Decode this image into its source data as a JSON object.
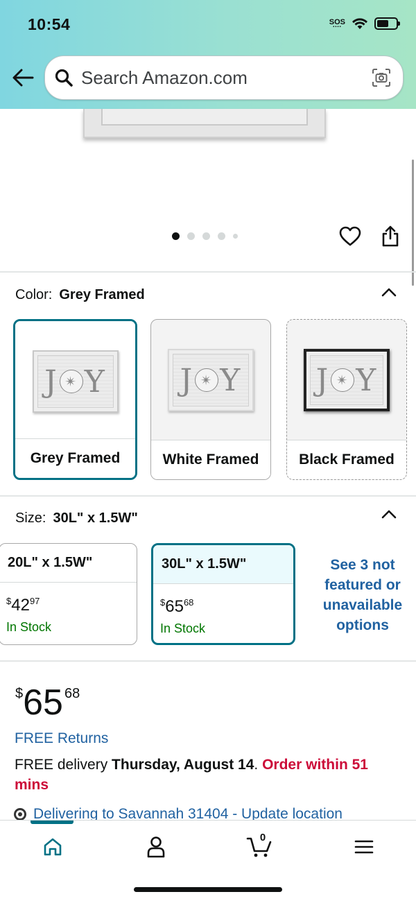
{
  "status_bar": {
    "time": "10:54",
    "sos": "SOS"
  },
  "search": {
    "placeholder": "Search Amazon.com"
  },
  "gallery": {
    "image_count": 5,
    "active_index": 0
  },
  "color": {
    "label": "Color:",
    "selected": "Grey Framed",
    "options": [
      {
        "name": "Grey Framed",
        "art_text": "J",
        "art_text2": "Y",
        "selected": true
      },
      {
        "name": "White Framed",
        "art_text": "J",
        "art_text2": "Y",
        "selected": false
      },
      {
        "name": "Black Framed",
        "art_text": "J",
        "art_text2": "Y",
        "selected": false
      }
    ]
  },
  "size": {
    "label": "Size:",
    "selected": "30L\" x 1.5W\"",
    "options": [
      {
        "name": "20L\" x 1.5W\"",
        "currency": "$",
        "dollars": "42",
        "cents": "97",
        "stock": "In Stock"
      },
      {
        "name": "30L\" x 1.5W\"",
        "currency": "$",
        "dollars": "65",
        "cents": "68",
        "stock": "In Stock"
      }
    ],
    "see_more": "See 3 not featured or unavailable options"
  },
  "price": {
    "currency": "$",
    "dollars": "65",
    "cents": "68"
  },
  "free_returns": "FREE Returns",
  "delivery": {
    "prefix": "FREE delivery ",
    "date": "Thursday, August 14",
    "separator": ". ",
    "urgency": "Order within 51 mins"
  },
  "location": "Delivering to Savannah 31404 - Update location",
  "nav": {
    "cart_count": "0"
  },
  "colors": {
    "accent": "#007185",
    "link": "#2162a1",
    "in_stock": "#007600",
    "urgent": "#cc0c39"
  }
}
